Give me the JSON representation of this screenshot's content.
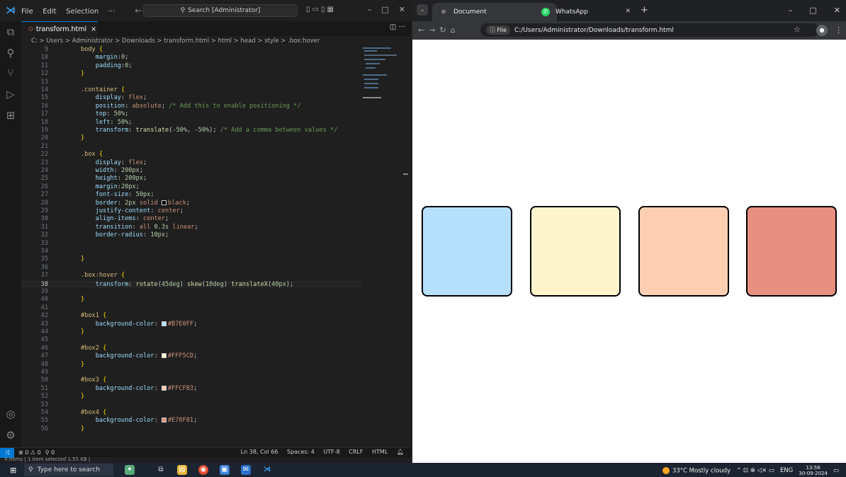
{
  "vscode": {
    "menu": [
      "File",
      "Edit",
      "Selection",
      "···"
    ],
    "search_placeholder": "Search [Administrator]",
    "tab": {
      "label": "transform.html",
      "close": "×"
    },
    "breadcrumb": "C: > Users > Administrator > Downloads > transform.html > html > head > style > .box:hover",
    "lines": [
      {
        "n": "9",
        "html": "<span class=\"t-sel\">body</span> <span class=\"t-pun\">{</span>"
      },
      {
        "n": "10",
        "html": "    <span class=\"t-prop\">margin</span>:<span class=\"t-num\">0</span>;"
      },
      {
        "n": "11",
        "html": "    <span class=\"t-prop\">padding</span>:<span class=\"t-num\">0</span>;"
      },
      {
        "n": "12",
        "html": "<span class=\"t-pun\">}</span>"
      },
      {
        "n": "13",
        "html": ""
      },
      {
        "n": "14",
        "html": "<span class=\"t-sel\">.container</span> <span class=\"t-pun\">{</span>"
      },
      {
        "n": "15",
        "html": "    <span class=\"t-prop\">display</span>: <span class=\"t-val\">flex</span>;"
      },
      {
        "n": "16",
        "html": "    <span class=\"t-prop\">position</span>: <span class=\"t-val\">absolute</span>; <span class=\"t-com\">/* Add this to enable positioning */</span>"
      },
      {
        "n": "17",
        "html": "    <span class=\"t-prop\">top</span>: <span class=\"t-num\">50%</span>;"
      },
      {
        "n": "18",
        "html": "    <span class=\"t-prop\">left</span>: <span class=\"t-num\">50%</span>;"
      },
      {
        "n": "19",
        "html": "    <span class=\"t-prop\">transform</span>: <span class=\"t-fn\">translate</span>(<span class=\"t-num\">-50%</span>, <span class=\"t-num\">-50%</span>); <span class=\"t-com\">/* Add a comma between values */</span>"
      },
      {
        "n": "20",
        "html": "<span class=\"t-pun\">}</span>"
      },
      {
        "n": "21",
        "html": ""
      },
      {
        "n": "22",
        "html": "<span class=\"t-sel\">.box</span> <span class=\"t-pun\">{</span>"
      },
      {
        "n": "23",
        "html": "    <span class=\"t-prop\">display</span>: <span class=\"t-val\">flex</span>;"
      },
      {
        "n": "24",
        "html": "    <span class=\"t-prop\">width</span>: <span class=\"t-num\">200px</span>;"
      },
      {
        "n": "25",
        "html": "    <span class=\"t-prop\">height</span>: <span class=\"t-num\">200px</span>;"
      },
      {
        "n": "26",
        "html": "    <span class=\"t-prop\">margin</span>:<span class=\"t-num\">20px</span>;"
      },
      {
        "n": "27",
        "html": "    <span class=\"t-prop\">font-size</span>: <span class=\"t-num\">50px</span>;"
      },
      {
        "n": "28",
        "html": "    <span class=\"t-prop\">border</span>: <span class=\"t-num\">2px</span> <span class=\"t-val\">solid</span> <span class=\"swatch\" style=\"background:#000\"></span><span class=\"t-val\">black</span>;"
      },
      {
        "n": "29",
        "html": "    <span class=\"t-prop\">justify-content</span>: <span class=\"t-val\">center</span>;"
      },
      {
        "n": "30",
        "html": "    <span class=\"t-prop\">align-items</span>: <span class=\"t-val\">center</span>;"
      },
      {
        "n": "31",
        "html": "    <span class=\"t-prop\">transition</span>: <span class=\"t-val\">all</span> <span class=\"t-num\">0.3s</span> <span class=\"t-val\">linear</span>;"
      },
      {
        "n": "32",
        "html": "    <span class=\"t-prop\">border-radius</span>: <span class=\"t-num\">10px</span>;"
      },
      {
        "n": "33",
        "html": ""
      },
      {
        "n": "34",
        "html": ""
      },
      {
        "n": "35",
        "html": "<span class=\"t-pun\">}</span>"
      },
      {
        "n": "36",
        "html": ""
      },
      {
        "n": "37",
        "html": "<span class=\"t-sel\">.box:hover</span> <span class=\"t-pun\">{</span>"
      },
      {
        "n": "38",
        "html": "    <span class=\"t-prop\">transform</span>: <span class=\"t-fn\">rotate</span>(<span class=\"t-num\">45deg</span>) <span class=\"t-fn\">skew</span>(<span class=\"t-num\">10deg</span>) <span class=\"t-fn\">translateX</span>(<span class=\"t-num\">40px</span>);",
        "active": true
      },
      {
        "n": "39",
        "html": ""
      },
      {
        "n": "40",
        "html": "<span class=\"t-pun\">}</span>"
      },
      {
        "n": "41",
        "html": ""
      },
      {
        "n": "42",
        "html": "<span class=\"t-sel\">#box1</span> <span class=\"t-pun\">{</span>"
      },
      {
        "n": "43",
        "html": "    <span class=\"t-prop\">background-color</span>: <span class=\"swatch\" style=\"background:#B7E0FF\"></span><span class=\"t-val\">#B7E0FF</span>;"
      },
      {
        "n": "44",
        "html": "<span class=\"t-pun\">}</span>"
      },
      {
        "n": "45",
        "html": ""
      },
      {
        "n": "46",
        "html": "<span class=\"t-sel\">#box2</span> <span class=\"t-pun\">{</span>"
      },
      {
        "n": "47",
        "html": "    <span class=\"t-prop\">background-color</span>: <span class=\"swatch\" style=\"background:#FFF5CD\"></span><span class=\"t-val\">#FFF5CD</span>;"
      },
      {
        "n": "48",
        "html": "<span class=\"t-pun\">}</span>"
      },
      {
        "n": "49",
        "html": ""
      },
      {
        "n": "50",
        "html": "<span class=\"t-sel\">#box3</span> <span class=\"t-pun\">{</span>"
      },
      {
        "n": "51",
        "html": "    <span class=\"t-prop\">background-color</span>: <span class=\"swatch\" style=\"background:#FFCFB3\"></span><span class=\"t-val\">#FFCFB3</span>;"
      },
      {
        "n": "52",
        "html": "<span class=\"t-pun\">}</span>"
      },
      {
        "n": "53",
        "html": ""
      },
      {
        "n": "54",
        "html": "<span class=\"t-sel\">#box4</span> <span class=\"t-pun\">{</span>"
      },
      {
        "n": "55",
        "html": "    <span class=\"t-prop\">background-color</span>: <span class=\"swatch\" style=\"background:#E78F81\"></span><span class=\"t-val\">#E78F81</span>;"
      },
      {
        "n": "56",
        "html": "<span class=\"t-pun\">}</span>"
      }
    ],
    "status": {
      "problems": "⊗ 0 ⚠ 0",
      "ports": "⚲ 0",
      "position": "Ln 38, Col 66",
      "spaces": "Spaces: 4",
      "encoding": "UTF-8",
      "eol": "CRLF",
      "language": "HTML",
      "items": "4 items | 1 item selected 1.55 KB |"
    }
  },
  "chrome": {
    "tabs": [
      {
        "label": "Document",
        "active": true
      },
      {
        "label": "WhatsApp",
        "active": false
      }
    ],
    "address": "C:/Users/Administrator/Downloads/transform.html",
    "address_chip": "File",
    "boxes": [
      {
        "id": "box1",
        "color": "#B7E0FF"
      },
      {
        "id": "box2",
        "color": "#FFF5CD"
      },
      {
        "id": "box3",
        "color": "#FFCFB3"
      },
      {
        "id": "box4",
        "color": "#E78F81"
      }
    ]
  },
  "taskbar": {
    "search_placeholder": "Type here to search",
    "weather": "33°C  Mostly cloudy",
    "lang": "ENG",
    "time": "13:56",
    "date": "30-09-2024"
  }
}
